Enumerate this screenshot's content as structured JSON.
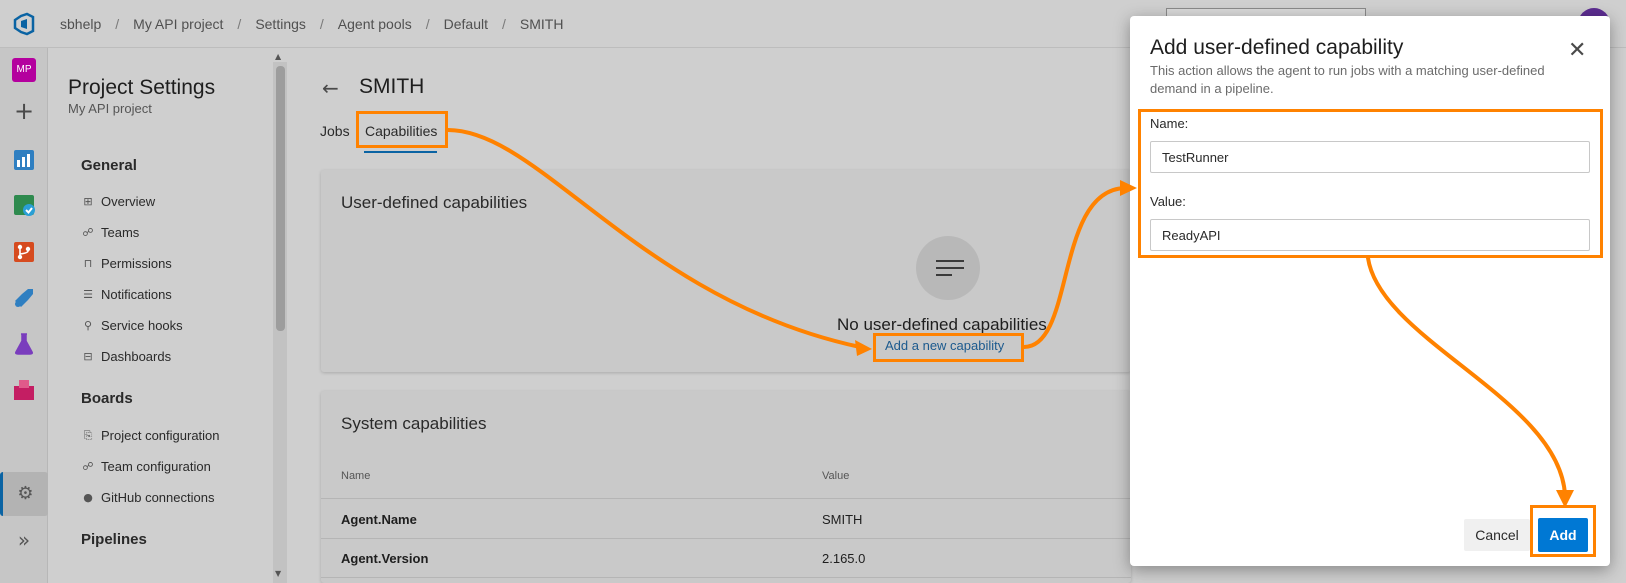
{
  "breadcrumb": [
    "sbhelp",
    "My API project",
    "Settings",
    "Agent pools",
    "Default",
    "SMITH"
  ],
  "rail": {
    "project_initials": "MP"
  },
  "settings_nav": {
    "title": "Project Settings",
    "subtitle": "My API project",
    "sections": [
      {
        "label": "General",
        "items": [
          "Overview",
          "Teams",
          "Permissions",
          "Notifications",
          "Service hooks",
          "Dashboards"
        ]
      },
      {
        "label": "Boards",
        "items": [
          "Project configuration",
          "Team configuration",
          "GitHub connections"
        ]
      },
      {
        "label": "Pipelines",
        "items": []
      }
    ]
  },
  "page": {
    "title": "SMITH",
    "tabs": [
      {
        "label": "Jobs",
        "active": false
      },
      {
        "label": "Capabilities",
        "active": true
      }
    ]
  },
  "user_capabilities": {
    "title": "User-defined capabilities",
    "empty_text": "No user-defined capabilities",
    "add_link": "Add a new capability"
  },
  "system_capabilities": {
    "title": "System capabilities",
    "columns": [
      "Name",
      "Value"
    ],
    "rows": [
      {
        "name": "Agent.Name",
        "value": "SMITH"
      },
      {
        "name": "Agent.Version",
        "value": "2.165.0"
      }
    ]
  },
  "dialog": {
    "title": "Add user-defined capability",
    "description": "This action allows the agent to run jobs with a matching user-defined demand in a pipeline.",
    "name_label": "Name:",
    "name_value": "TestRunner",
    "value_label": "Value:",
    "value_value": "ReadyAPI",
    "cancel_label": "Cancel",
    "add_label": "Add"
  },
  "colors": {
    "highlight": "#ff8200",
    "accent": "#0078d4",
    "link": "#1c5a8e"
  }
}
